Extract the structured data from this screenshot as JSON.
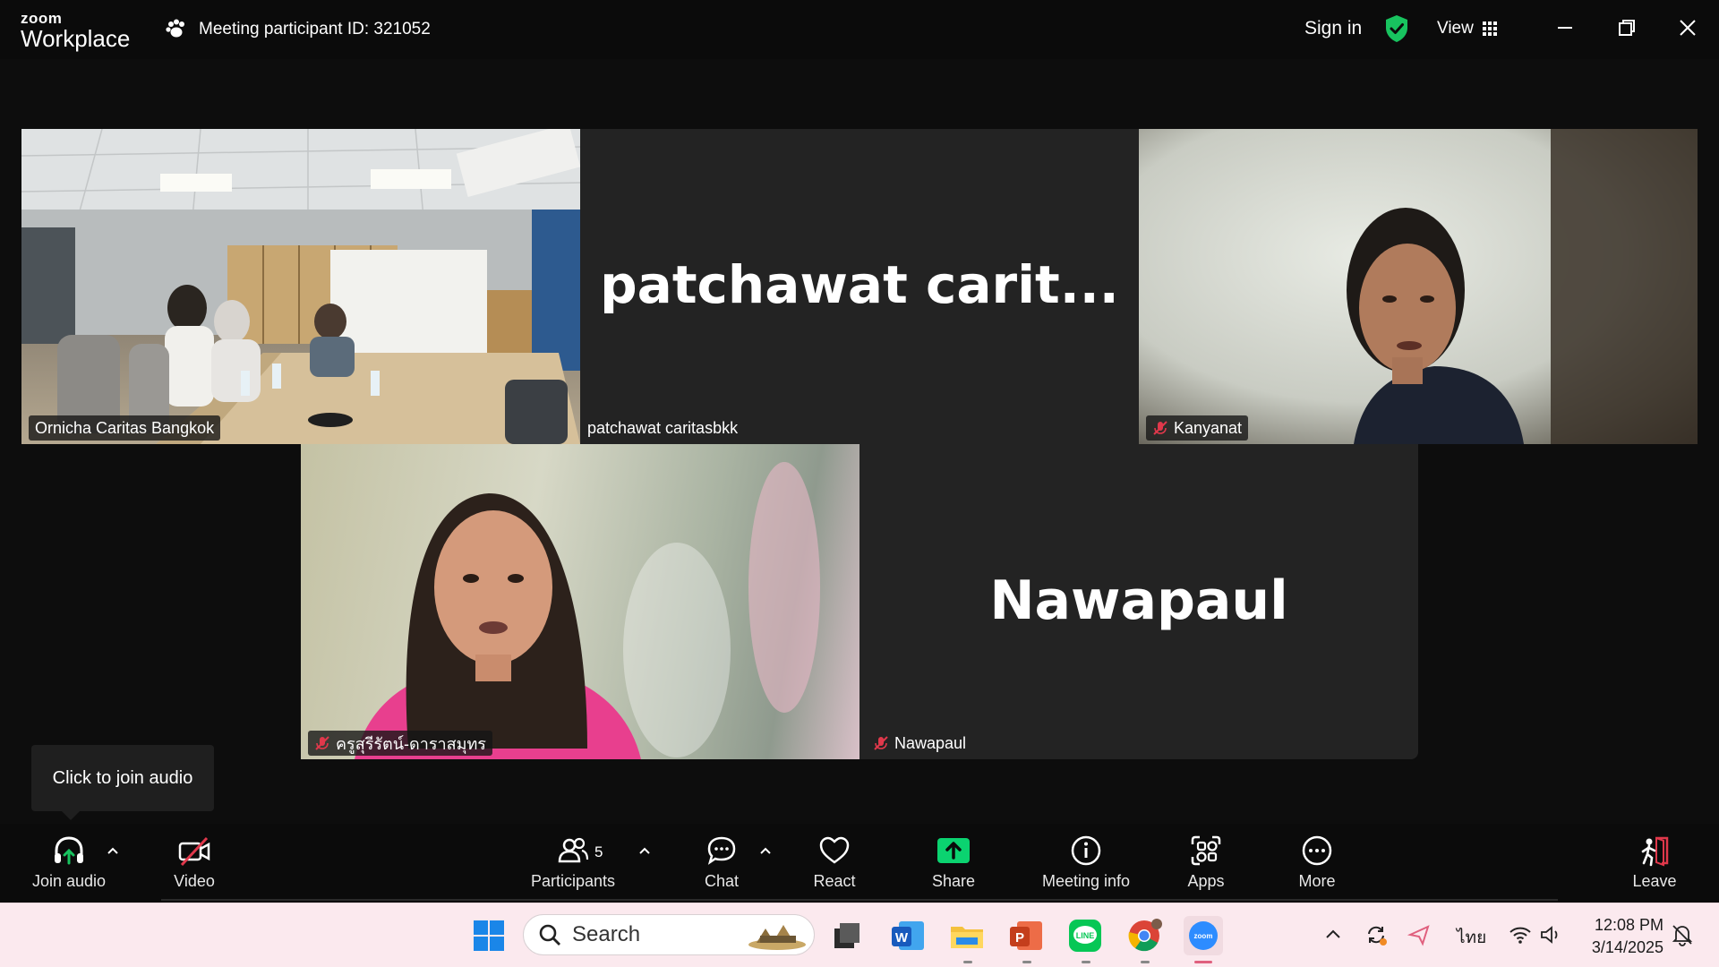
{
  "app": {
    "logo_line1": "zoom",
    "logo_line2": "Workplace",
    "meeting_id_text": "Meeting participant ID: 321052",
    "sign_in": "Sign in",
    "view_label": "View"
  },
  "participants_tiles": [
    {
      "name": "Ornicha Caritas Bangkok",
      "muted": false,
      "video": true,
      "active_speaker": true
    },
    {
      "name": "patchawat caritasbkk",
      "display_name": "patchawat  carit...",
      "muted": false,
      "video": false
    },
    {
      "name": "Kanyanat",
      "muted": true,
      "video": true
    },
    {
      "name": "ครูสุรีรัตน์-ดาราสมุทร",
      "muted": true,
      "video": true
    },
    {
      "name": "Nawapaul",
      "display_name": "Nawapaul",
      "muted": true,
      "video": false
    }
  ],
  "tooltip": "Click to join audio",
  "toolbar": {
    "join_audio": "Join audio",
    "video": "Video",
    "participants": "Participants",
    "participants_count": "5",
    "chat": "Chat",
    "react": "React",
    "share": "Share",
    "meeting_info": "Meeting info",
    "apps": "Apps",
    "more": "More",
    "leave": "Leave"
  },
  "taskbar": {
    "search_placeholder": "Search",
    "language": "ไทย",
    "time": "12:08 PM",
    "date": "3/14/2025"
  },
  "colors": {
    "active_speaker": "#2fd487",
    "share_green": "#0bd370",
    "mute_red": "#e0384b",
    "leave_red": "#e0384b"
  }
}
